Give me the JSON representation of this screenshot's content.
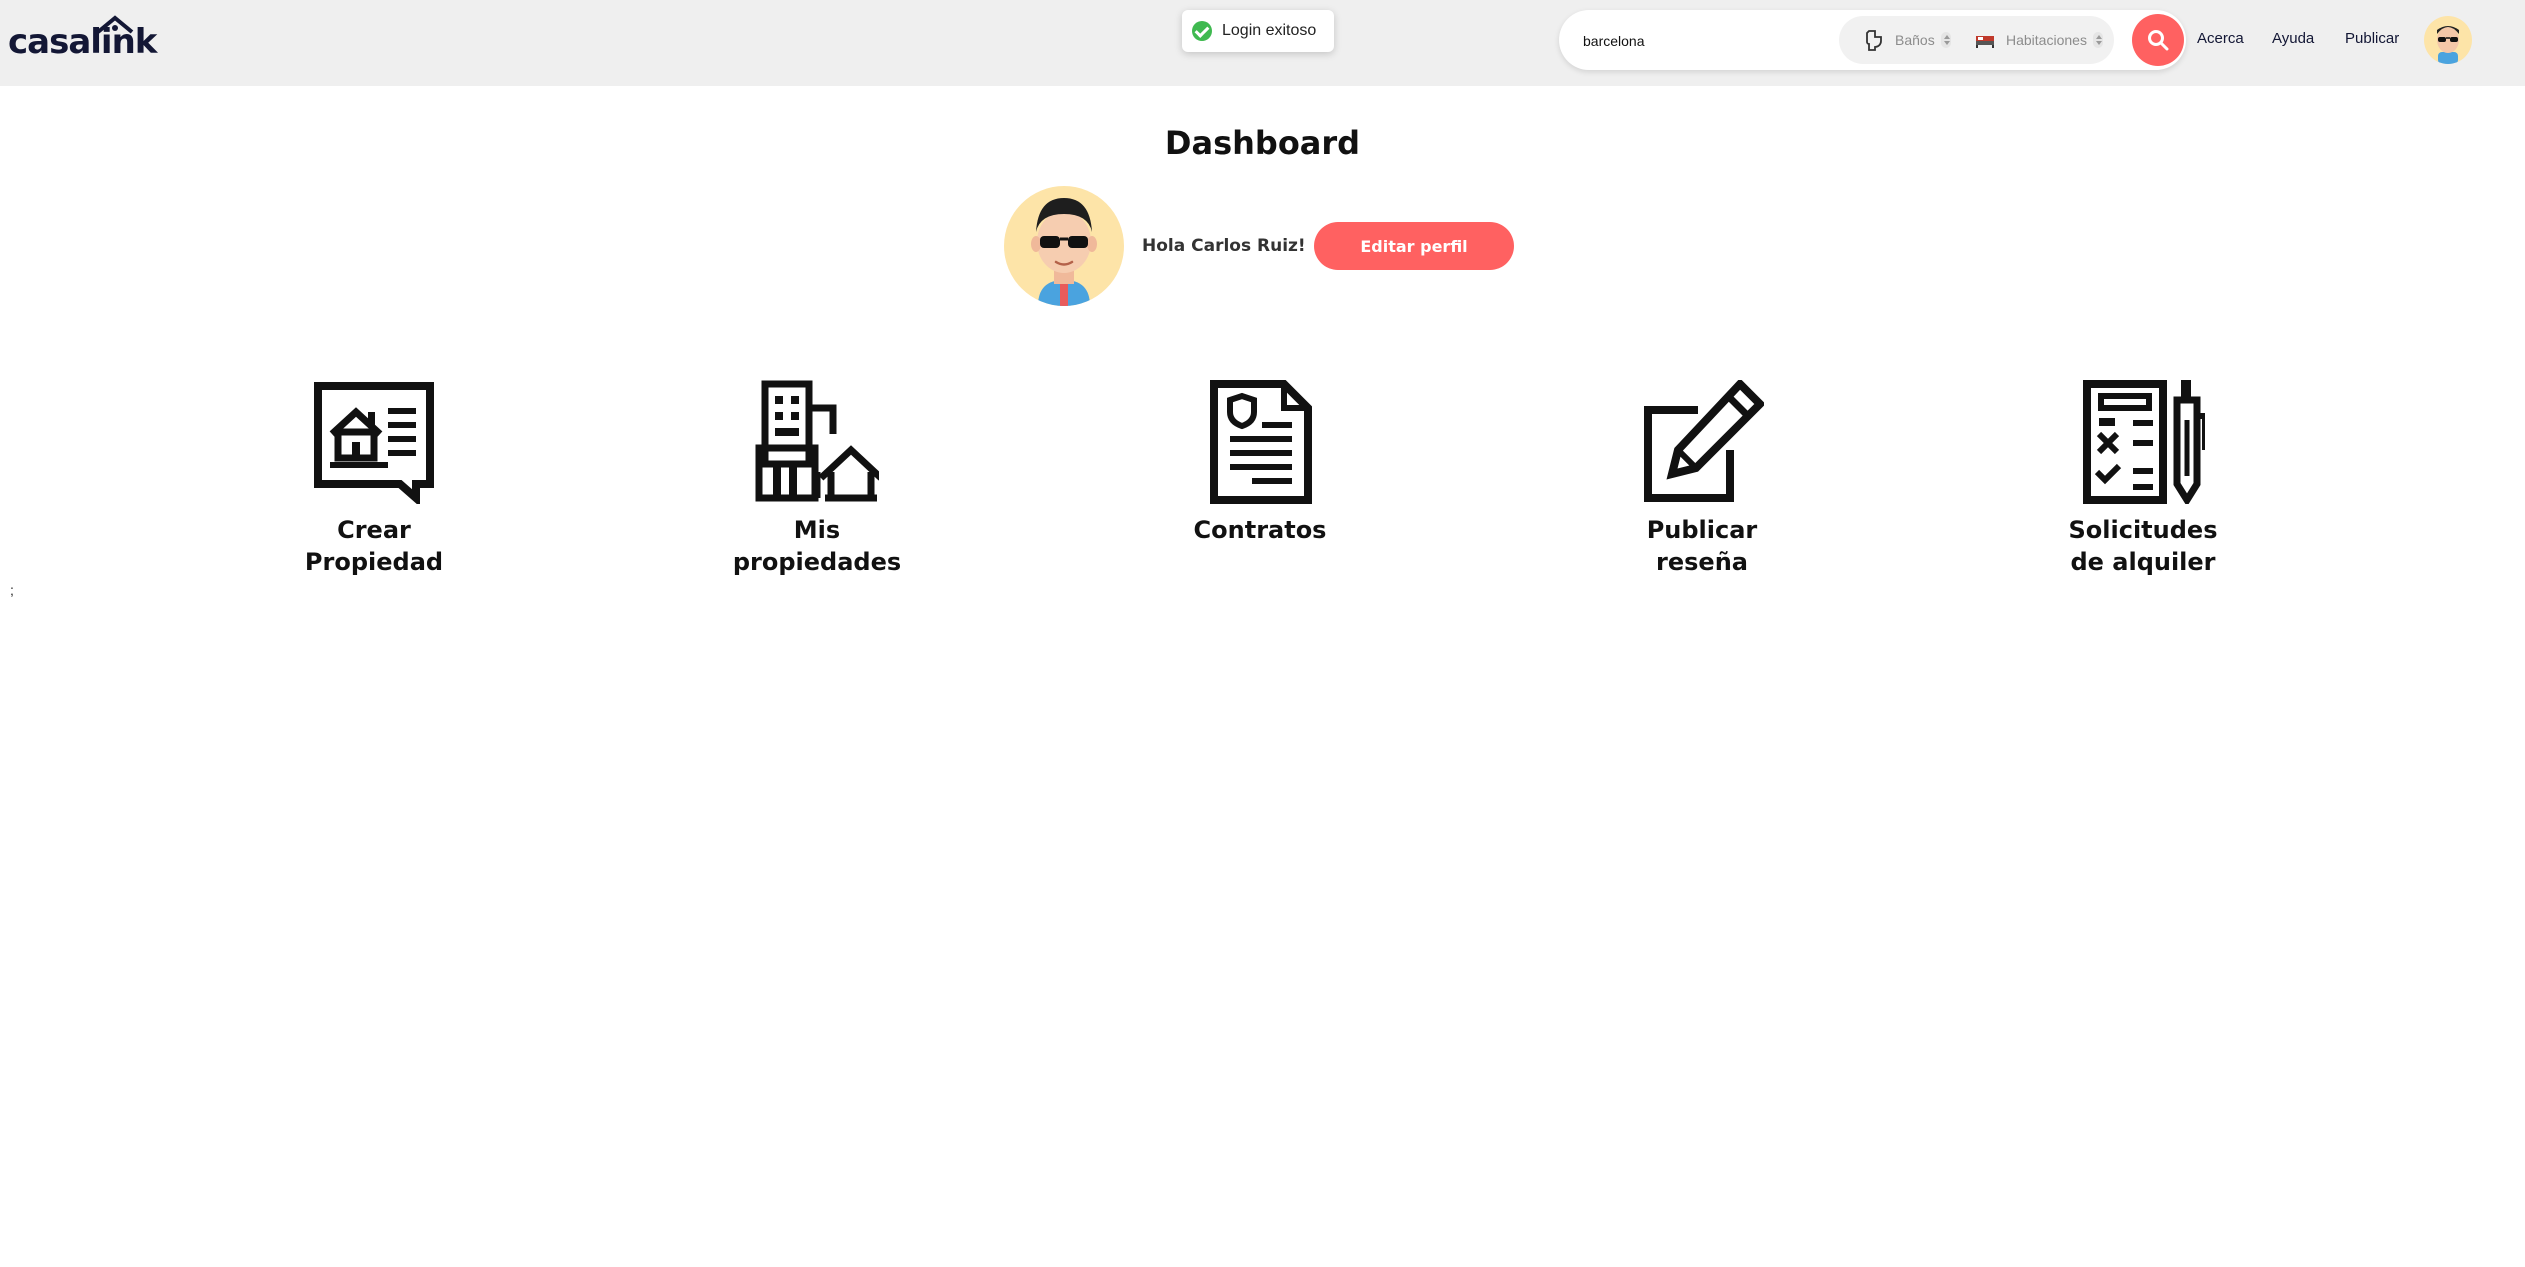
{
  "header": {
    "logo_text": "casalink",
    "toast": {
      "message": "Login exitoso"
    },
    "search": {
      "query": "barcelona",
      "bathrooms_placeholder": "Baños",
      "rooms_placeholder": "Habitaciones"
    },
    "nav": [
      "Acerca",
      "Ayuda",
      "Publicar"
    ]
  },
  "dashboard": {
    "title": "Dashboard",
    "greeting": "Hola Carlos Ruiz!",
    "edit_button": "Editar perfil",
    "cards": [
      {
        "label": "Crear\nPropiedad",
        "icon": "property-listing-icon"
      },
      {
        "label": "Mis\npropiedades",
        "icon": "buildings-house-icon"
      },
      {
        "label": "Contratos",
        "icon": "contract-document-icon"
      },
      {
        "label": "Publicar\nreseña",
        "icon": "edit-pencil-icon"
      },
      {
        "label": "Solicitudes\nde alquiler",
        "icon": "checklist-pen-icon"
      }
    ],
    "stray_text": ";"
  },
  "colors": {
    "accent": "#ff6161",
    "brand": "#131735",
    "header_bg": "#efefef",
    "avatar_bg": "#fde4a8"
  }
}
